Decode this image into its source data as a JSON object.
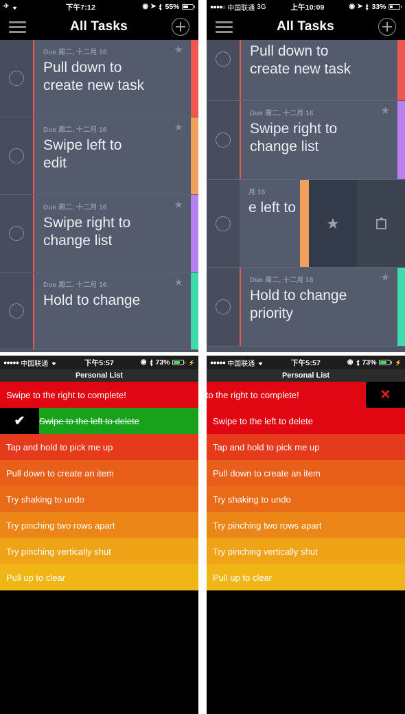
{
  "panels": {
    "top_left": {
      "status": {
        "airplane_icon": "✈",
        "wifi_icon": "wifi",
        "time": "下午7:12",
        "orientation_icon": "@",
        "location_icon": "➤",
        "bluetooth_icon": "bluetooth",
        "battery_text": "55%",
        "battery_pct": 55
      },
      "nav": {
        "menu_icon": "hamburger-icon",
        "title": "All Tasks",
        "add_icon": "plus-icon"
      },
      "tasks": [
        {
          "due": "Due 周二, 十二月 16",
          "title": "Pull down to\ncreate new task",
          "stripe": "#f1564f",
          "starred": true
        },
        {
          "due": "Due 周二, 十二月 16",
          "title": "Swipe left to\nedit",
          "stripe": "#f0a05a",
          "starred": true
        },
        {
          "due": "Due 周二, 十二月 16",
          "title": "Swipe right to\nchange list",
          "stripe": "#b77ff0",
          "starred": true
        },
        {
          "due": "Due 周二, 十二月 16",
          "title": "Hold to change",
          "stripe": "#3edcaa",
          "starred": true
        }
      ]
    },
    "top_right": {
      "status": {
        "signal_dots": "●●●●○",
        "carrier": "中国联通",
        "network": "3G",
        "time": "上午10:09",
        "orientation_icon": "@",
        "location_icon": "➤",
        "bluetooth_icon": "bluetooth",
        "battery_text": "33%",
        "battery_pct": 33
      },
      "nav": {
        "menu_icon": "hamburger-icon",
        "title": "All Tasks",
        "add_icon": "plus-icon"
      },
      "tasks": [
        {
          "due": "",
          "title": "Pull down to\ncreate new task",
          "stripe": "#f1564f",
          "starred": false
        },
        {
          "due": "Due 周二, 十二月 16",
          "title": "Swipe right to\nchange list",
          "stripe": "#b77ff0",
          "starred": true
        },
        {
          "due": "月 16",
          "title": "e left to",
          "stripe": "#f0a05a",
          "starred": true,
          "swiped": true,
          "actions": {
            "star_icon": "star-icon",
            "delete_icon": "trash-icon"
          }
        },
        {
          "due": "Due 周二, 十二月 16",
          "title": "Hold to change\npriority",
          "stripe": "#3edcaa",
          "starred": true
        }
      ]
    },
    "bottom_left": {
      "status": {
        "signal_dots": "●●●●●",
        "carrier": "中国联通",
        "wifi_icon": "wifi",
        "time": "下午5:57",
        "orientation_icon": "@",
        "bluetooth_icon": "bluetooth",
        "battery_text": "73%",
        "battery_pct": 73,
        "charging": true
      },
      "header_title": "Personal List",
      "rows": [
        {
          "label": "Swipe to the right to complete!",
          "color": "#e00712",
          "done": false
        },
        {
          "label": "Swipe to the left to delete",
          "color": "#18a21c",
          "done": true,
          "check_icon": "checkmark-icon"
        },
        {
          "label": "Tap and hold to pick me up",
          "color": "#e53a1b",
          "done": false
        },
        {
          "label": "Pull down to create an item",
          "color": "#e85f19",
          "done": false
        },
        {
          "label": "Try shaking to undo",
          "color": "#e96a17",
          "done": false
        },
        {
          "label": "Try pinching two rows apart",
          "color": "#ec8717",
          "done": false
        },
        {
          "label": "Try pinching vertically shut",
          "color": "#efa316",
          "done": false
        },
        {
          "label": "Pull up to clear",
          "color": "#f0b616",
          "done": false
        }
      ]
    },
    "bottom_right": {
      "status": {
        "signal_dots": "●●●●●",
        "carrier": "中国联通",
        "wifi_icon": "wifi",
        "time": "下午5:57",
        "orientation_icon": "@",
        "bluetooth_icon": "bluetooth",
        "battery_text": "73%",
        "battery_pct": 73,
        "charging": true
      },
      "header_title": "Personal List",
      "rows": [
        {
          "label": "e to the right to complete!",
          "color": "#e00712",
          "done": false,
          "swiped": true,
          "delete_icon": "✕"
        },
        {
          "label": "Swipe to the left to delete",
          "color": "#e00712",
          "done": false
        },
        {
          "label": "Tap and hold to pick me up",
          "color": "#e53a1b",
          "done": false
        },
        {
          "label": "Pull down to create an item",
          "color": "#e85f19",
          "done": false
        },
        {
          "label": "Try shaking to undo",
          "color": "#e96a17",
          "done": false
        },
        {
          "label": "Try pinching two rows apart",
          "color": "#ec8717",
          "done": false
        },
        {
          "label": "Try pinching vertically shut",
          "color": "#efa316",
          "done": false
        },
        {
          "label": "Pull up to clear",
          "color": "#f0b616",
          "done": false
        }
      ]
    }
  }
}
